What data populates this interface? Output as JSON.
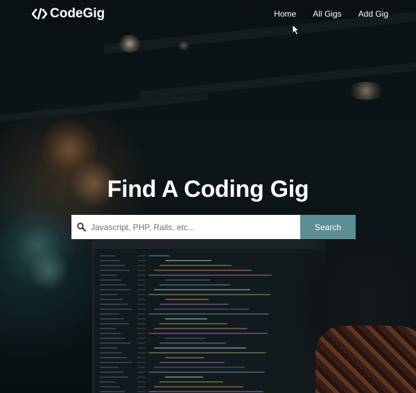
{
  "brand": {
    "logo_icon": "code-brackets-icon",
    "name": "CodeGig"
  },
  "nav": {
    "items": [
      {
        "label": "Home"
      },
      {
        "label": "All Gigs"
      },
      {
        "label": "Add Gig"
      }
    ]
  },
  "hero": {
    "title": "Find A Coding Gig"
  },
  "search": {
    "icon": "search-icon",
    "placeholder": "Javascript, PHP, Rails, etc...",
    "value": "",
    "button_label": "Search"
  },
  "colors": {
    "search_button": "#5c8f94",
    "text": "#ffffff"
  }
}
